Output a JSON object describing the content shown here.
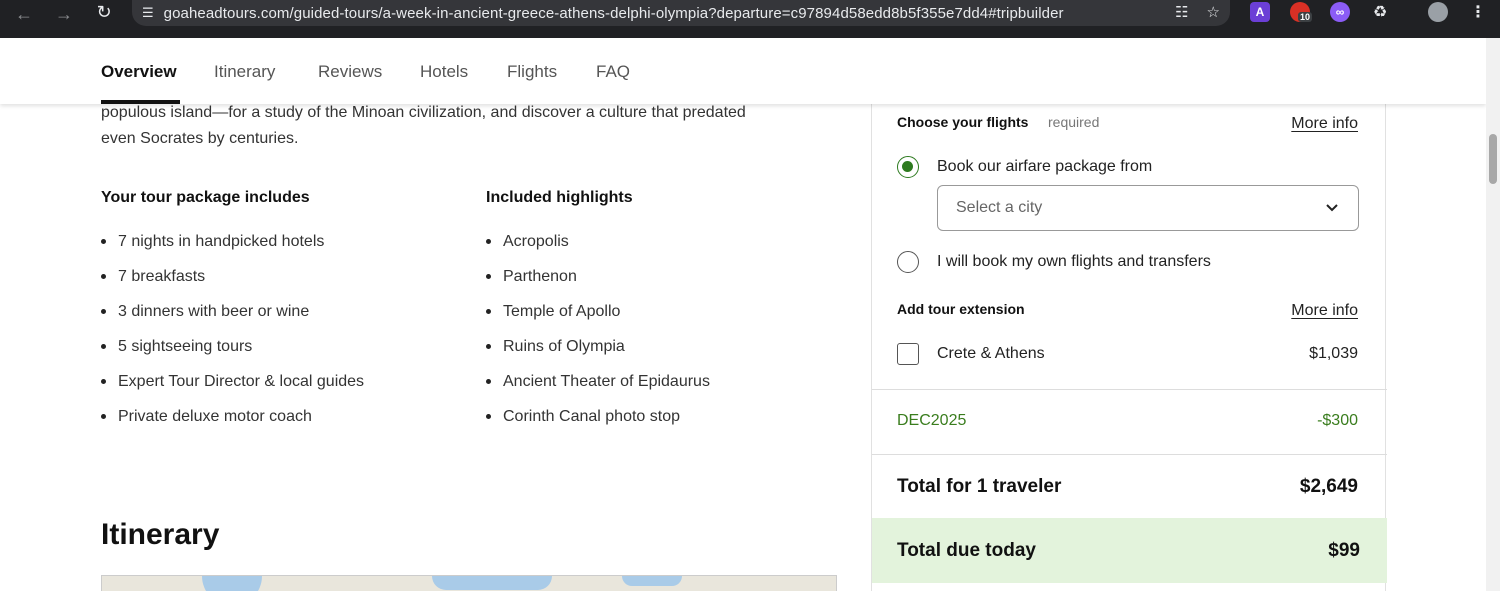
{
  "browser": {
    "url": "goaheadtours.com/guided-tours/a-week-in-ancient-greece-athens-delphi-olympia?departure=c97894d58edd8b5f355e7dd4#tripbuilder",
    "extension_badge": "10"
  },
  "tabs": [
    "Overview",
    "Itinerary",
    "Reviews",
    "Hotels",
    "Flights",
    "FAQ"
  ],
  "intro": {
    "line1": "populous island—for a study of the Minoan civilization, and discover a culture that predated",
    "line2": "even Socrates by centuries."
  },
  "package": {
    "title": "Your tour package includes",
    "items": [
      "7 nights in handpicked hotels",
      "7 breakfasts",
      "3 dinners with beer or wine",
      "5 sightseeing tours",
      "Expert Tour Director & local guides",
      "Private deluxe motor coach"
    ]
  },
  "highlights": {
    "title": "Included highlights",
    "items": [
      "Acropolis",
      "Parthenon",
      "Temple of Apollo",
      "Ruins of Olympia",
      "Ancient Theater of Epidaurus",
      "Corinth Canal photo stop"
    ]
  },
  "itinerary_heading": "Itinerary",
  "panel": {
    "flights_label": "Choose your flights",
    "required": "required",
    "more_info": "More info",
    "option_package": "Book our airfare package from",
    "city_placeholder": "Select a city",
    "option_own": "I will book my own flights and transfers",
    "extension_label": "Add tour extension",
    "extension_name": "Crete & Athens",
    "extension_price": "$1,039",
    "promo_code": "DEC2025",
    "promo_amount": "-$300",
    "total_label": "Total for 1 traveler",
    "total_value": "$2,649",
    "due_label": "Total due today",
    "due_value": "$99",
    "colors": {
      "accent_green": "#2d7a1f",
      "promo_green": "#3a7d1e",
      "due_bg": "#e3f3dc"
    }
  }
}
